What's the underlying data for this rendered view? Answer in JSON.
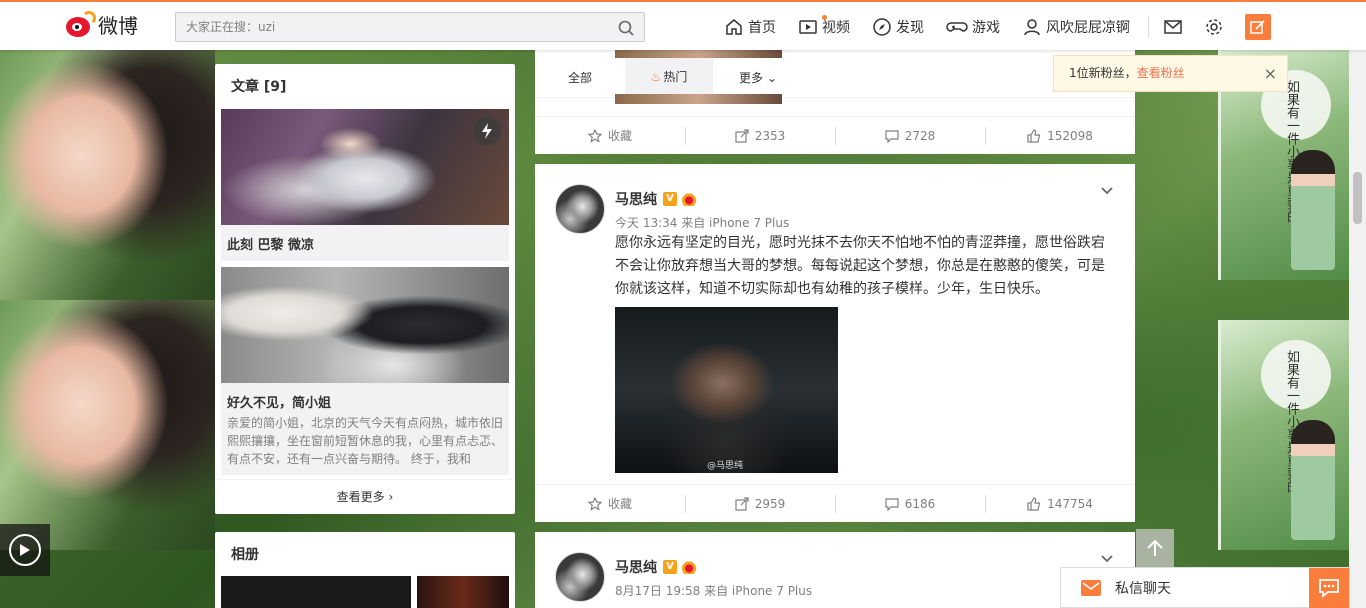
{
  "header": {
    "logo_text": "微博",
    "search_placeholder": "大家正在搜：uzi",
    "nav": [
      {
        "label": "首页",
        "icon": "home-icon"
      },
      {
        "label": "视频",
        "icon": "video-icon"
      },
      {
        "label": "发现",
        "icon": "compass-icon"
      },
      {
        "label": "游戏",
        "icon": "gamepad-icon"
      },
      {
        "label": "风吹屁屁凉锕",
        "icon": "user-icon"
      }
    ]
  },
  "articles": {
    "title": "文章 [9]",
    "items": [
      {
        "title": "此刻 巴黎 微凉"
      },
      {
        "title": "好久不见，简小姐",
        "desc": "亲爱的简小姐，北京的天气今天有点闷热，城市依旧熙熙攘攘，坐在窗前短暂休息的我，心里有点忐忑、有点不安，还有一点兴奋与期待。 终于，我和"
      }
    ],
    "more": "查看更多"
  },
  "album": {
    "title": "相册"
  },
  "feed": {
    "tabs": [
      {
        "label": "全部"
      },
      {
        "label": "热门"
      },
      {
        "label": "更多"
      }
    ],
    "first_actions": {
      "collect": "收藏",
      "repost": "2353",
      "comment": "2728",
      "like": "152098"
    },
    "posts": [
      {
        "author": "马思纯",
        "meta": "今天 13:34 来自 iPhone 7 Plus",
        "text": "愿你永远有坚定的目光，愿时光抹不去你天不怕地不怕的青涩莽撞，愿世俗跌宕不会让你放弃想当大哥的梦想。每每说起这个梦想，你总是在憨憨的傻笑，可是你就该这样，知道不切实际却也有幼稚的孩子模样。少年，生日快乐。",
        "watermark": "@马思纯",
        "actions": {
          "collect": "收藏",
          "repost": "2959",
          "comment": "6186",
          "like": "147754"
        }
      },
      {
        "author": "马思纯",
        "meta": "8月17日 19:58 来自 iPhone 7 Plus"
      }
    ]
  },
  "notice": {
    "text": "1位新粉丝，",
    "link": "查看粉丝"
  },
  "chat": {
    "label": "私信聊天"
  },
  "book": {
    "cover_text": "如果有一件小事是重要的"
  },
  "colors": {
    "accent": "#fa7d3c",
    "link": "#eb7350",
    "brand_red": "#e6162d"
  }
}
